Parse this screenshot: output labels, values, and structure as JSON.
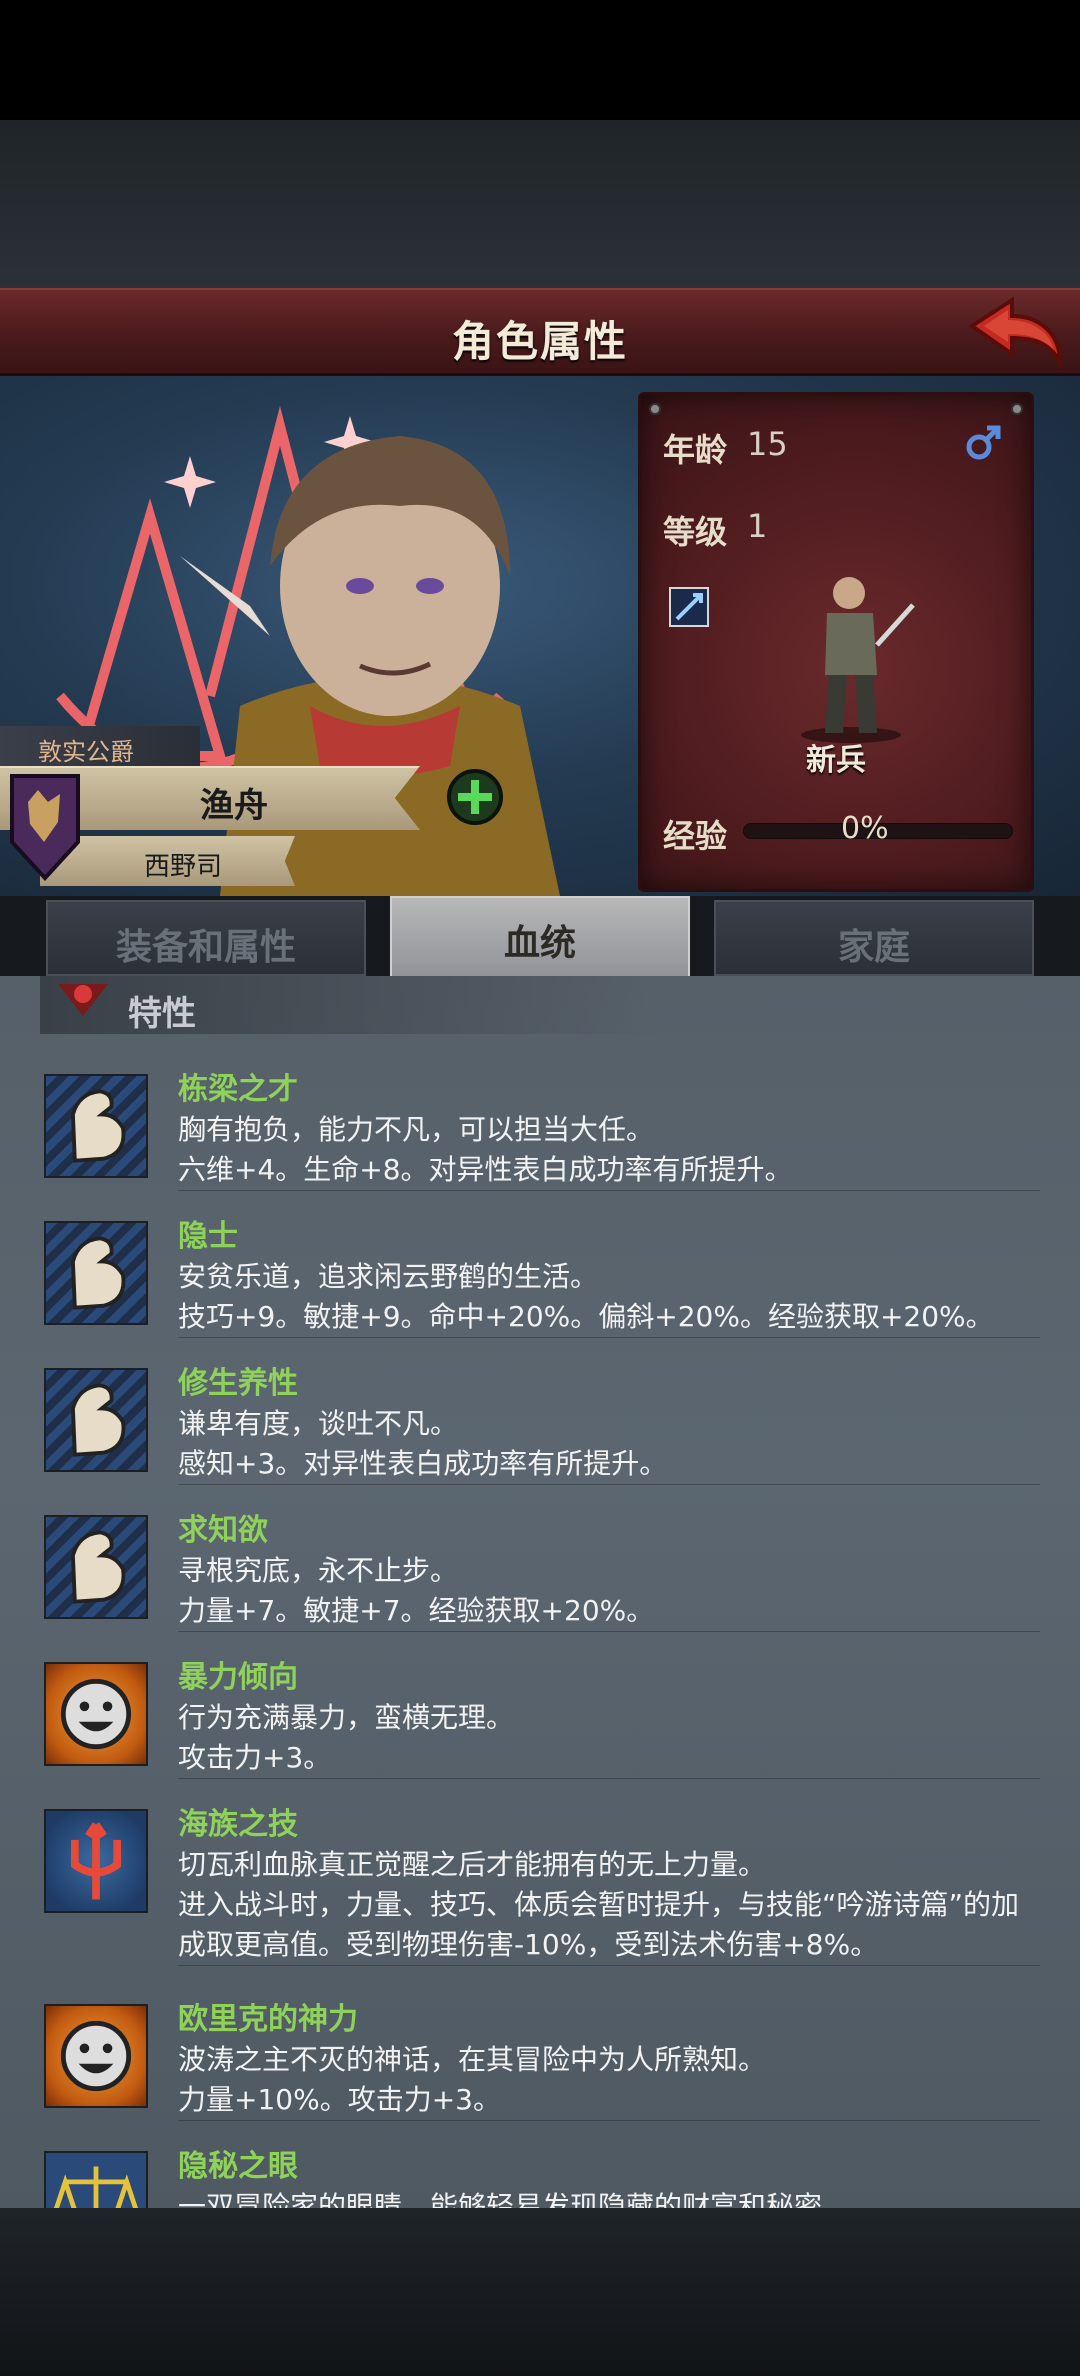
{
  "header": {
    "title": "角色属性"
  },
  "character": {
    "rank_title": "敦实公爵",
    "name": "渔舟",
    "origin": "西野司",
    "age_label": "年龄",
    "age": "15",
    "level_label": "等级",
    "level": "1",
    "class_name": "新兵",
    "exp_label": "经验",
    "exp_value": "0%",
    "exp_fraction": 0
  },
  "tabs": [
    {
      "label": "装备和属性",
      "active": false
    },
    {
      "label": "血统",
      "active": true
    },
    {
      "label": "家庭",
      "active": false
    }
  ],
  "section": {
    "label": "特性"
  },
  "traits": [
    {
      "name": "栋梁之才",
      "desc": "胸有抱负，能力不凡，可以担当大任。",
      "effects": [
        "六维+4。生命+8。对异性表白成功率有所提升。"
      ],
      "icon": "muscle-arm-icon"
    },
    {
      "name": "隐士",
      "desc": "安贫乐道，追求闲云野鹤的生活。",
      "effects": [
        "技巧+9。敏捷+9。命中+20%。偏斜+20%。经验获取+20%。"
      ],
      "icon": "muscle-arm-icon"
    },
    {
      "name": "修生养性",
      "desc": "谦卑有度，谈吐不凡。",
      "effects": [
        "感知+3。对异性表白成功率有所提升。"
      ],
      "icon": "muscle-arm-icon"
    },
    {
      "name": "求知欲",
      "desc": "寻根究底，永不止步。",
      "effects": [
        "力量+7。敏捷+7。经验获取+20%。"
      ],
      "icon": "muscle-arm-icon"
    },
    {
      "name": "暴力倾向",
      "desc": "行为充满暴力，蛮横无理。",
      "effects": [
        "攻击力+3。"
      ],
      "icon": "smiley-face-icon"
    },
    {
      "name": "海族之技",
      "desc": "切瓦利血脉真正觉醒之后才能拥有的无上力量。",
      "effects": [
        "进入战斗时，力量、技巧、体质会暂时提升，与技能“吟游诗篇”的加",
        "成取更高值。受到物理伤害-10%，受到法术伤害+8%。"
      ],
      "icon": "trident-icon"
    },
    {
      "name": "欧里克的神力",
      "desc": "波涛之主不灭的神话，在其冒险中为人所熟知。",
      "effects": [
        "力量+10%。攻击力+3。"
      ],
      "icon": "smiley-face-icon"
    },
    {
      "name": "隐秘之眼",
      "desc": "一双冒险家的眼睛，能够轻易发现隐藏的财富和秘密。",
      "effects": [],
      "icon": "scales-icon"
    }
  ]
}
